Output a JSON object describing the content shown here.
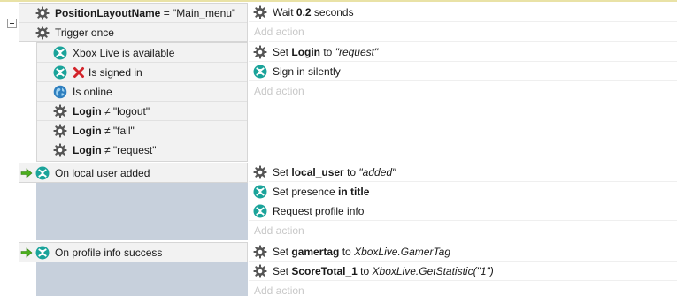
{
  "events": [
    {
      "conditions": [
        {
          "parts": [
            {
              "t": "PositionLayoutName",
              "b": true
            },
            {
              "t": " = \"Main_menu\""
            }
          ],
          "icon": "gear-icon"
        },
        {
          "parts": [
            {
              "t": "Trigger once"
            }
          ],
          "icon": "gear-icon"
        }
      ],
      "actions": [
        {
          "parts": [
            {
              "t": "Wait "
            },
            {
              "t": "0.2",
              "b": true
            },
            {
              "t": " seconds"
            }
          ],
          "icon": "gear-icon"
        }
      ],
      "add_action": "Add action"
    },
    {
      "conditions": [
        {
          "parts": [
            {
              "t": "Xbox Live is available"
            }
          ],
          "icon": "xbox-icon"
        },
        {
          "parts": [
            {
              "t": "Is signed in"
            }
          ],
          "icon": "xbox-icon",
          "inverted": true
        },
        {
          "parts": [
            {
              "t": "Is online"
            }
          ],
          "icon": "globe-icon"
        },
        {
          "parts": [
            {
              "t": "Login",
              "b": true
            },
            {
              "t": " ≠ \"logout\""
            }
          ],
          "icon": "gear-icon"
        },
        {
          "parts": [
            {
              "t": "Login",
              "b": true
            },
            {
              "t": " ≠ \"fail\""
            }
          ],
          "icon": "gear-icon"
        },
        {
          "parts": [
            {
              "t": "Login",
              "b": true
            },
            {
              "t": " ≠ \"request\""
            }
          ],
          "icon": "gear-icon"
        }
      ],
      "actions": [
        {
          "parts": [
            {
              "t": "Set "
            },
            {
              "t": "Login",
              "b": true
            },
            {
              "t": " to "
            },
            {
              "t": "\"request\"",
              "i": true
            }
          ],
          "icon": "gear-icon"
        },
        {
          "parts": [
            {
              "t": "Sign in silently"
            }
          ],
          "icon": "xbox-icon"
        }
      ],
      "add_action": "Add action"
    },
    {
      "conditions": [
        {
          "parts": [
            {
              "t": "On local user added"
            }
          ],
          "icon": "xbox-icon",
          "trigger": true
        }
      ],
      "actions": [
        {
          "parts": [
            {
              "t": "Set "
            },
            {
              "t": "local_user",
              "b": true
            },
            {
              "t": " to "
            },
            {
              "t": "\"added\"",
              "i": true
            }
          ],
          "icon": "gear-icon"
        },
        {
          "parts": [
            {
              "t": "Set presence "
            },
            {
              "t": "in title",
              "b": true
            }
          ],
          "icon": "xbox-icon"
        },
        {
          "parts": [
            {
              "t": "Request profile info"
            }
          ],
          "icon": "xbox-icon"
        }
      ],
      "add_action": "Add action"
    },
    {
      "conditions": [
        {
          "parts": [
            {
              "t": "On profile info success"
            }
          ],
          "icon": "xbox-icon",
          "trigger": true
        }
      ],
      "actions": [
        {
          "parts": [
            {
              "t": "Set "
            },
            {
              "t": "gamertag",
              "b": true
            },
            {
              "t": " to "
            },
            {
              "t": "XboxLive.GamerTag",
              "i": true
            }
          ],
          "icon": "gear-icon"
        },
        {
          "parts": [
            {
              "t": "Set "
            },
            {
              "t": "ScoreTotal_1",
              "b": true
            },
            {
              "t": " to "
            },
            {
              "t": "XboxLive.GetStatistic(\"1\")",
              "i": true
            }
          ],
          "icon": "gear-icon"
        }
      ],
      "add_action": "Add action"
    }
  ],
  "colors": {
    "xbox": "#1aa39a",
    "gear": "#555555",
    "trigger_arrow": "#4caf1e",
    "invert_x": "#d3242b",
    "add_action": "#c8c8c8"
  }
}
